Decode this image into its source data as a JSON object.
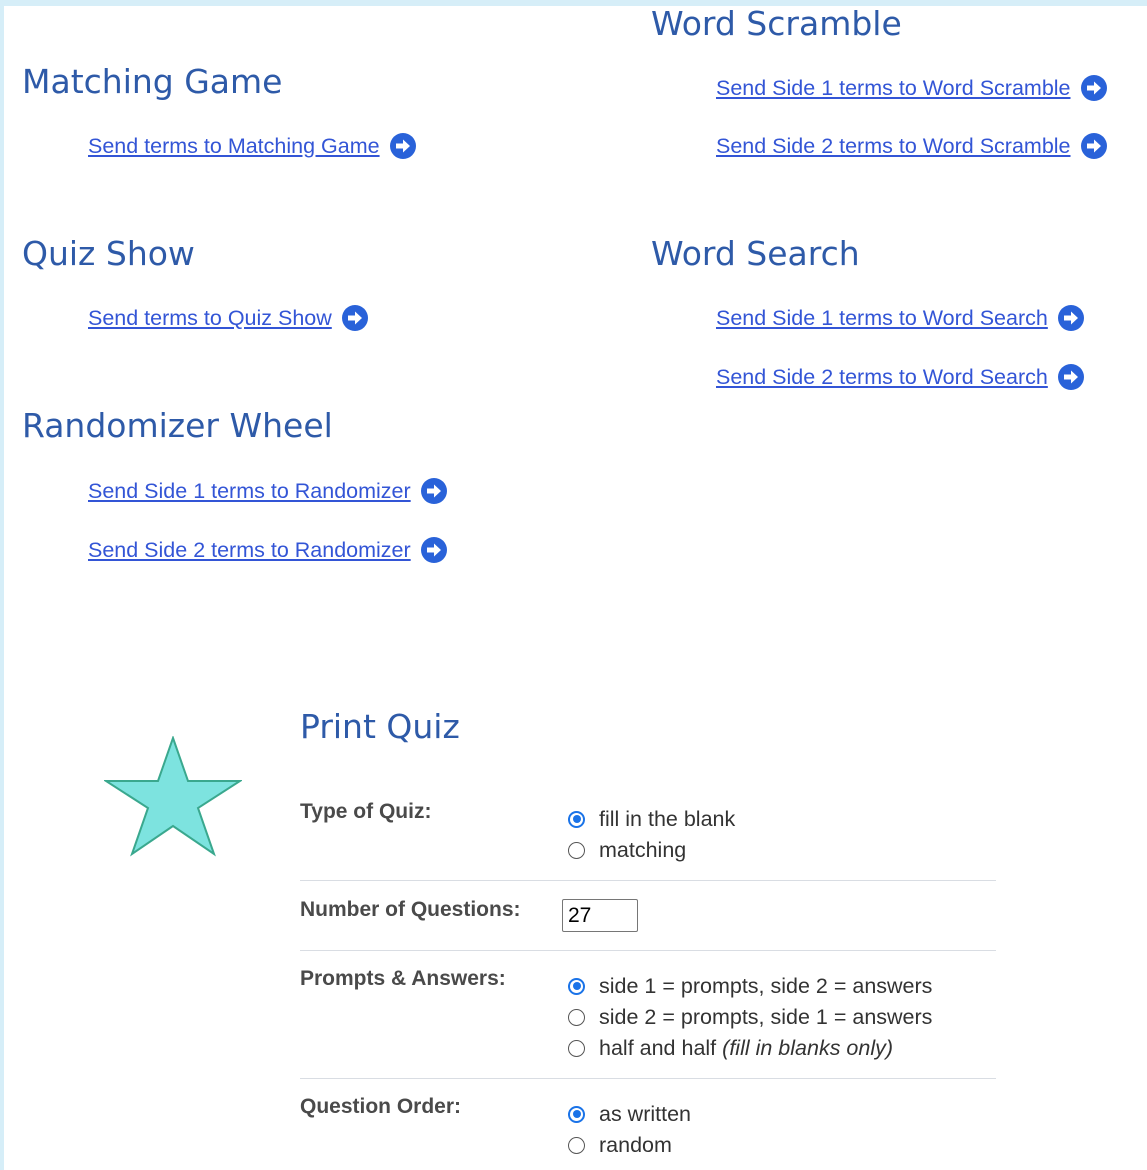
{
  "sections": {
    "matching_game": {
      "title": "Matching Game",
      "links": [
        "Send terms to Matching Game"
      ]
    },
    "word_scramble": {
      "title": "Word Scramble",
      "links": [
        "Send Side 1 terms to Word Scramble",
        "Send Side 2 terms to Word Scramble"
      ]
    },
    "quiz_show": {
      "title": "Quiz Show",
      "links": [
        "Send terms to Quiz Show"
      ]
    },
    "word_search": {
      "title": "Word Search",
      "links": [
        "Send Side 1 terms to Word Search",
        "Send Side 2 terms to Word Search"
      ]
    },
    "randomizer_wheel": {
      "title": "Randomizer Wheel",
      "links": [
        "Send Side 1 terms to Randomizer",
        "Send Side 2 terms to Randomizer"
      ]
    }
  },
  "print_quiz": {
    "title": "Print Quiz",
    "type_of_quiz": {
      "label": "Type of Quiz:",
      "options": [
        "fill in the blank",
        "matching"
      ],
      "selected": "fill in the blank"
    },
    "number_of_questions": {
      "label": "Number of Questions:",
      "value": "27"
    },
    "prompts_answers": {
      "label": "Prompts & Answers:",
      "options": [
        "side 1 = prompts, side 2 = answers",
        "side 2 = prompts, side 1 = answers",
        "half and half"
      ],
      "note": "(fill in blanks only)",
      "selected": "side 1 = prompts, side 2 = answers"
    },
    "question_order": {
      "label": "Question Order:",
      "options": [
        "as written",
        "random"
      ],
      "selected": "as written"
    }
  },
  "icons": {
    "arrow": "arrow-circle-right-icon",
    "star": "star-icon"
  },
  "colors": {
    "heading": "#2e5aa8",
    "link": "#3355d6",
    "arrow_icon": "#2962d9",
    "radio_checked": "#1a73e8",
    "star_fill": "#7de3df",
    "star_stroke": "#3aa88e",
    "frame": "#d6eef8"
  }
}
